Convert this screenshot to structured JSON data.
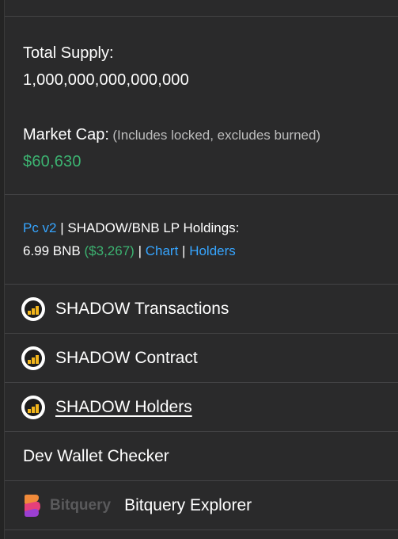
{
  "supply": {
    "label": "Total Supply:",
    "value": "1,000,000,000,000,000"
  },
  "market_cap": {
    "label": "Market Cap:",
    "note": "(Includes locked, excludes burned)",
    "value": "$60,630"
  },
  "lp": {
    "pc_link": "Pc v2",
    "separator": "|",
    "holdings_label": "SHADOW/BNB LP Holdings:",
    "bnb_amount": "6.99 BNB",
    "usd_amount": "($3,267)",
    "chart_link": "Chart",
    "holders_link": "Holders"
  },
  "links": [
    {
      "label": "SHADOW Transactions",
      "icon": "bscscan-icon"
    },
    {
      "label": "SHADOW Contract",
      "icon": "bscscan-icon"
    },
    {
      "label": "SHADOW Holders",
      "icon": "bscscan-icon"
    },
    {
      "label": "Dev Wallet Checker",
      "icon": ""
    },
    {
      "label": "Bitquery Explorer",
      "icon": "bitquery-icon",
      "brand": "Bitquery"
    }
  ],
  "colors": {
    "background": "#2a2a2b",
    "link": "#36a5ff",
    "positive": "#3cb371",
    "icon_accent": "#f2b51c"
  }
}
